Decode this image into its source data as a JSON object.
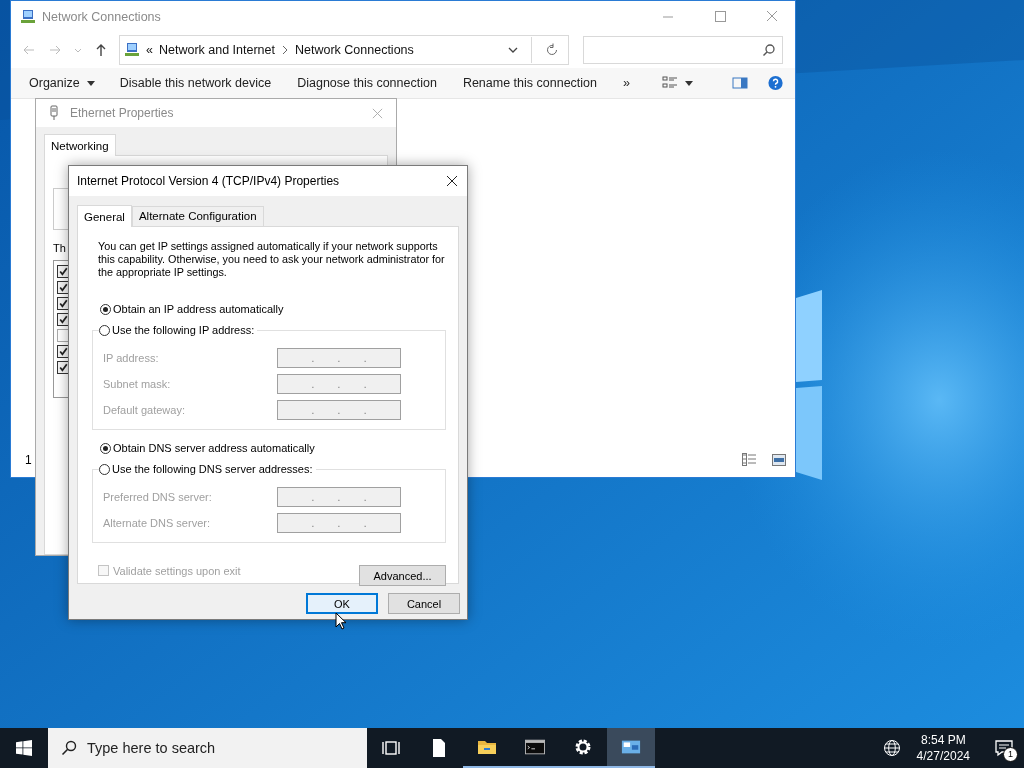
{
  "explorer": {
    "title": "Network Connections",
    "breadcrumb_prefix": "«",
    "breadcrumb": [
      "Network and Internet",
      "Network Connections"
    ],
    "toolbar": [
      "Organize",
      "Disable this network device",
      "Diagnose this connection",
      "Rename this connection"
    ],
    "toolbar_more": "»",
    "status_bar": "1"
  },
  "ethernet": {
    "title": "Ethernet Properties",
    "tabs": [
      {
        "label": "Networking",
        "selected": true
      }
    ],
    "label_fragment": "Th",
    "components": [
      {
        "checked": true
      },
      {
        "checked": true
      },
      {
        "checked": true
      },
      {
        "checked": true
      },
      {
        "checked": false
      },
      {
        "checked": true
      },
      {
        "checked": true
      }
    ]
  },
  "ipv4": {
    "title": "Internet Protocol Version 4 (TCP/IPv4) Properties",
    "tabs": [
      {
        "label": "General",
        "selected": true
      },
      {
        "label": "Alternate Configuration",
        "selected": false
      }
    ],
    "description": "You can get IP settings assigned automatically if your network supports this capability. Otherwise, you need to ask your network administrator for the appropriate IP settings.",
    "separator": ".",
    "ip_mode": [
      {
        "label": "Obtain an IP address automatically",
        "selected": true
      },
      {
        "label": "Use the following IP address:",
        "selected": false
      }
    ],
    "ip_fields": [
      {
        "label": "IP address:",
        "disabled": true
      },
      {
        "label": "Subnet mask:",
        "disabled": true
      },
      {
        "label": "Default gateway:",
        "disabled": true
      }
    ],
    "dns_mode": [
      {
        "label": "Obtain DNS server address automatically",
        "selected": true
      },
      {
        "label": "Use the following DNS server addresses:",
        "selected": false
      }
    ],
    "dns_fields": [
      {
        "label": "Preferred DNS server:",
        "disabled": true
      },
      {
        "label": "Alternate DNS server:",
        "disabled": true
      }
    ],
    "validate": {
      "label": "Validate settings upon exit",
      "checked": false,
      "disabled": true
    },
    "advanced": "Advanced...",
    "buttons": [
      {
        "label": "OK",
        "default": true
      },
      {
        "label": "Cancel",
        "default": false
      }
    ]
  },
  "taskbar": {
    "search_placeholder": "Type here to search",
    "apps": [
      {
        "kind": "taskview",
        "running": false,
        "active": false
      },
      {
        "kind": "document",
        "running": false,
        "active": false
      },
      {
        "kind": "folder",
        "running": true,
        "active": false
      },
      {
        "kind": "terminal",
        "running": true,
        "active": false
      },
      {
        "kind": "gear",
        "running": true,
        "active": false
      },
      {
        "kind": "network",
        "running": true,
        "active": true
      }
    ],
    "time": "8:54 PM",
    "date": "4/27/2024",
    "notifications": "1"
  }
}
